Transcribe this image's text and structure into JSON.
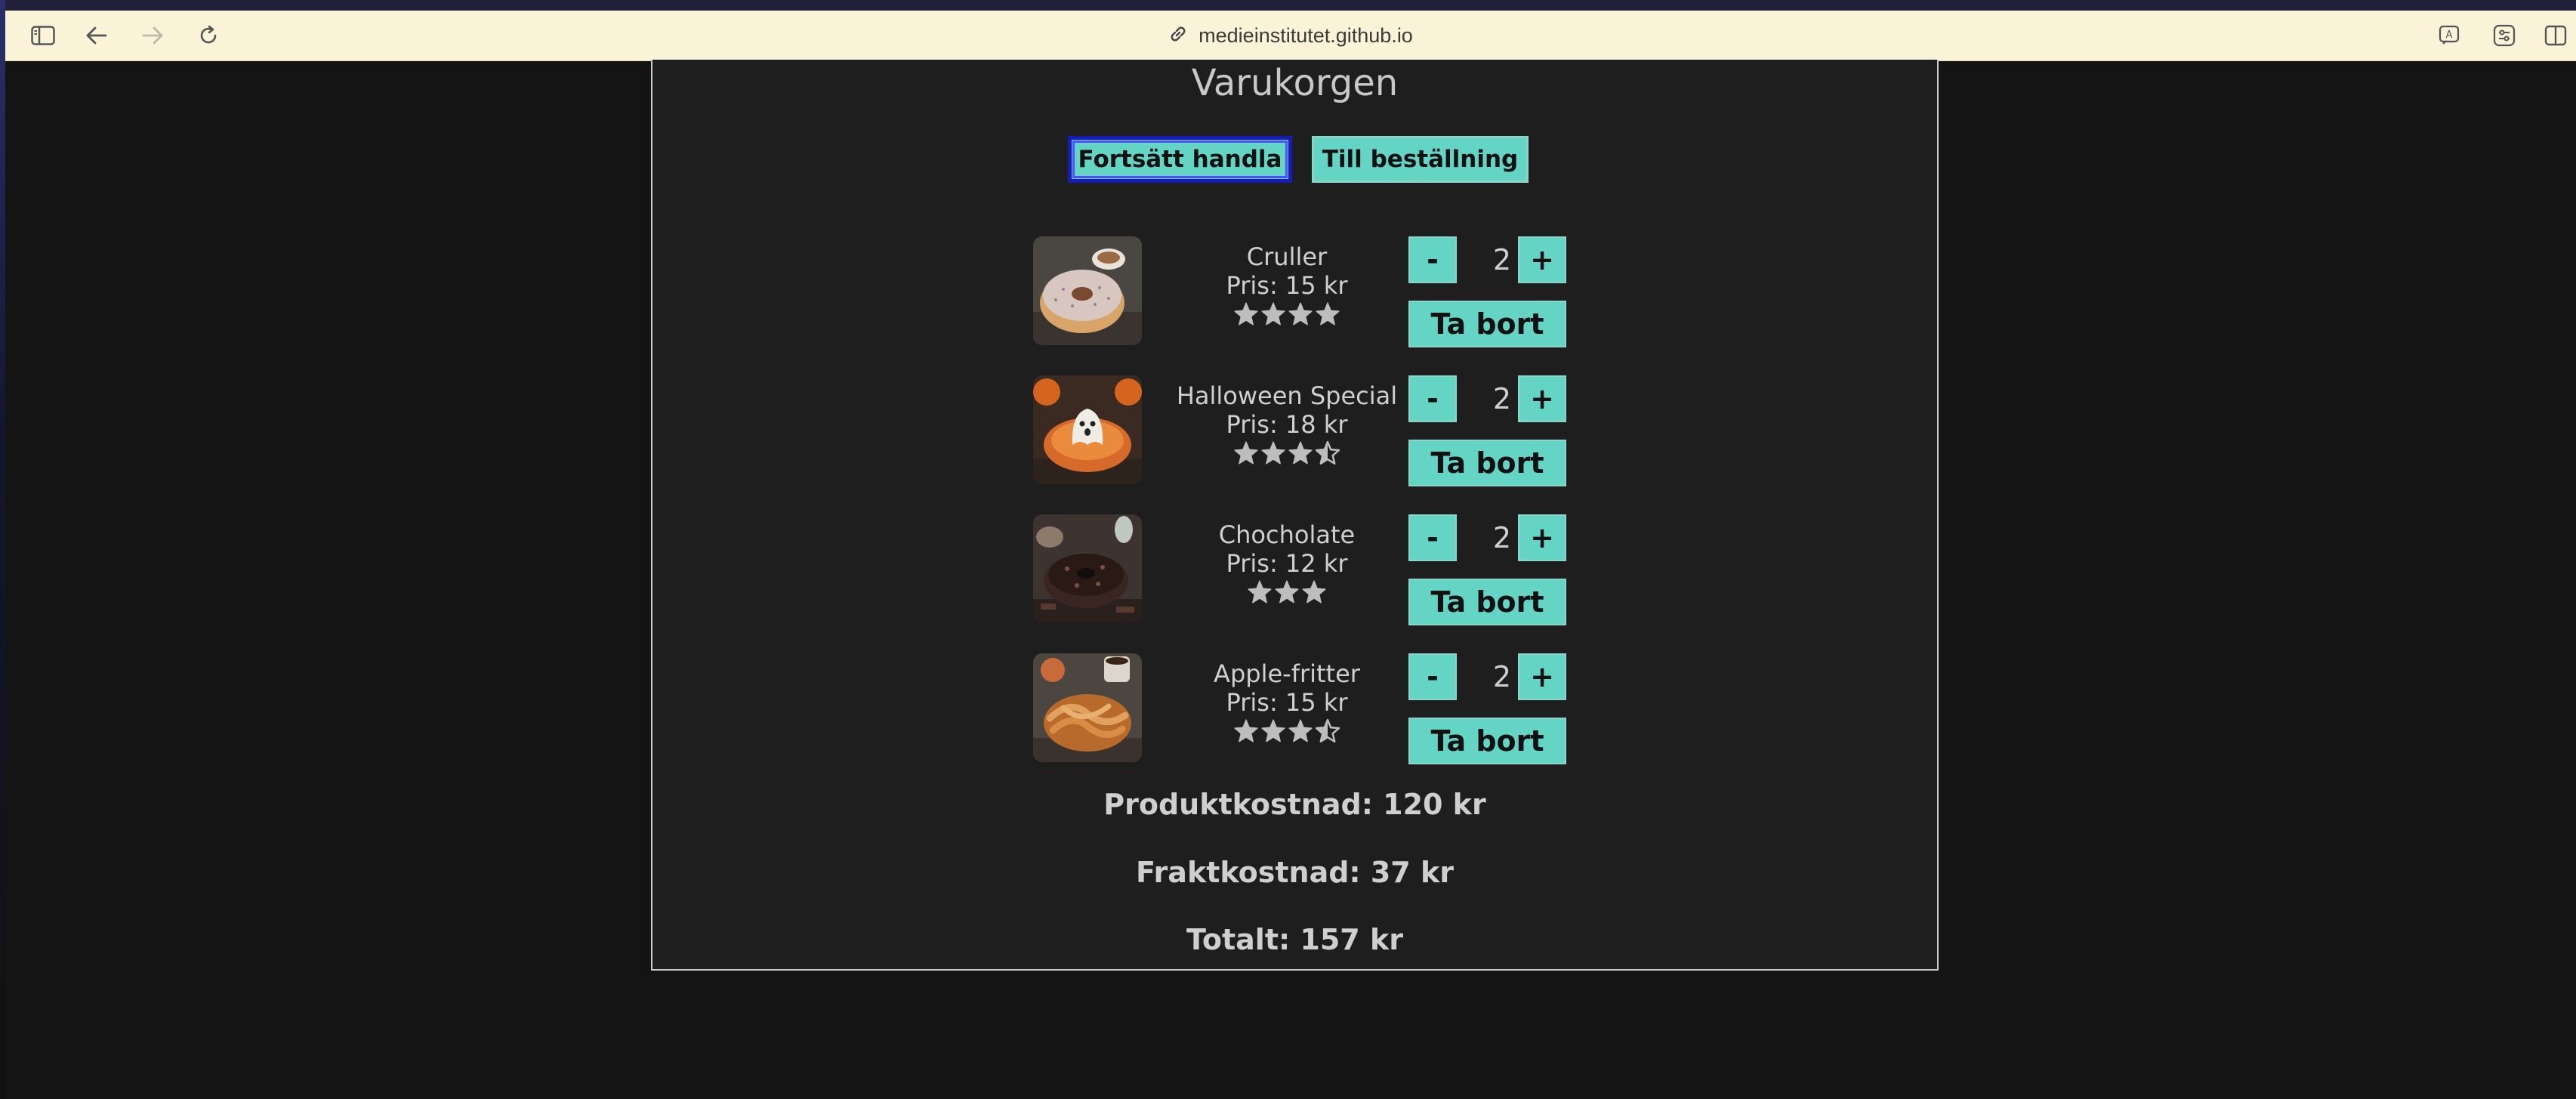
{
  "browser": {
    "url": "medieinstitutet.github.io",
    "icons": {
      "sidebar": "sidebar-icon",
      "back": "back-arrow-icon",
      "forward": "forward-arrow-icon",
      "reload": "reload-icon",
      "link": "link-icon",
      "translate": "translate-icon",
      "reader": "page-settings-icon",
      "split": "split-view-icon"
    }
  },
  "cart": {
    "title": "Varukorgen",
    "continue_label": "Fortsätt handla",
    "checkout_label": "Till beställning",
    "items": [
      {
        "name": "Cruller",
        "price": "Pris: 15 kr",
        "rating": 4,
        "quantity": "2",
        "minus": "-",
        "plus": "+",
        "remove": "Ta bort",
        "image": "cruller-donut-photo"
      },
      {
        "name": "Halloween Special",
        "price": "Pris: 18 kr",
        "rating": 3.5,
        "quantity": "2",
        "minus": "-",
        "plus": "+",
        "remove": "Ta bort",
        "image": "halloween-donut-photo"
      },
      {
        "name": "Chocholate",
        "price": "Pris: 12 kr",
        "rating": 3,
        "quantity": "2",
        "minus": "-",
        "plus": "+",
        "remove": "Ta bort",
        "image": "chocolate-donut-photo"
      },
      {
        "name": "Apple-fritter",
        "price": "Pris: 15 kr",
        "rating": 3.5,
        "quantity": "2",
        "minus": "-",
        "plus": "+",
        "remove": "Ta bort",
        "image": "apple-fritter-photo"
      }
    ],
    "product_cost": "Produktkostnad: 120 kr",
    "shipping_cost": "Fraktkostnad: 37 kr",
    "total": "Totalt: 157 kr"
  },
  "colors": {
    "button": "#64d4c4",
    "focus": "#1a1ab8",
    "panel": "#1e1e1e",
    "toolbar": "#fbf3d8"
  }
}
